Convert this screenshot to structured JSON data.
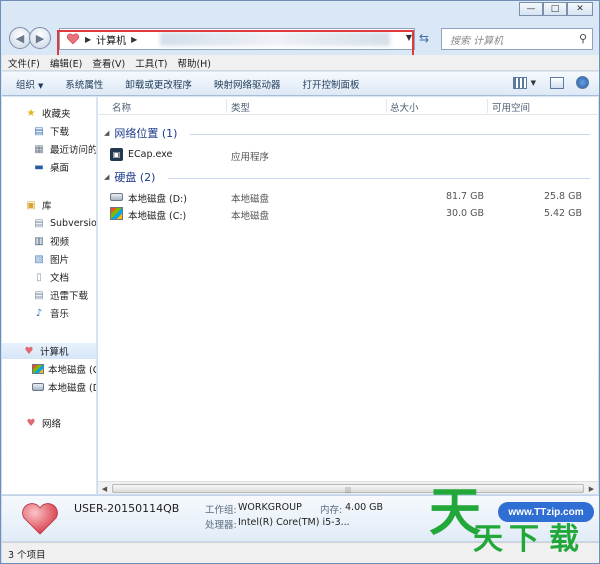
{
  "caption": {
    "minimize": "—",
    "maximize": "□",
    "close": "✕"
  },
  "address": {
    "crumb": "计算机"
  },
  "search": {
    "placeholder": "搜索 计算机"
  },
  "menu": [
    "文件(F)",
    "编辑(E)",
    "查看(V)",
    "工具(T)",
    "帮助(H)"
  ],
  "commands": [
    "组织",
    "系统属性",
    "卸载或更改程序",
    "映射网络驱动器",
    "打开控制面板"
  ],
  "nav": {
    "favorites": "收藏夹",
    "fav_items": [
      "下载",
      "最近访问的",
      "桌面"
    ],
    "libraries": "库",
    "lib_items": [
      "Subversion",
      "视频",
      "图片",
      "文档",
      "迅雷下载",
      "音乐"
    ],
    "computer": "计算机",
    "comp_items": [
      "本地磁盘 (C",
      "本地磁盘 (D"
    ],
    "network": "网络"
  },
  "columns": {
    "name": "名称",
    "type": "类型",
    "total": "总大小",
    "free": "可用空间"
  },
  "groups": {
    "network": "网络位置 (1)",
    "disks": "硬盘 (2)"
  },
  "rows": {
    "ecap": {
      "name": "ECap.exe",
      "type": "应用程序"
    },
    "d": {
      "name": "本地磁盘 (D:)",
      "type": "本地磁盘",
      "total": "81.7 GB",
      "free": "25.8 GB"
    },
    "c": {
      "name": "本地磁盘 (C:)",
      "type": "本地磁盘",
      "total": "30.0 GB",
      "free": "5.42 GB"
    }
  },
  "details": {
    "pc_name": "USER-20150114QB",
    "workgroup_label": "工作组:",
    "workgroup": "WORKGROUP",
    "memory_label": "内存:",
    "memory": "4.00 GB",
    "cpu_label": "处理器:",
    "cpu": "Intel(R) Core(TM) i5-3..."
  },
  "status": {
    "text": "3 个项目"
  },
  "watermark": {
    "url": "www.TTzip.com",
    "c1": "天",
    "c2": "天",
    "c3": "下",
    "c4": "载"
  }
}
